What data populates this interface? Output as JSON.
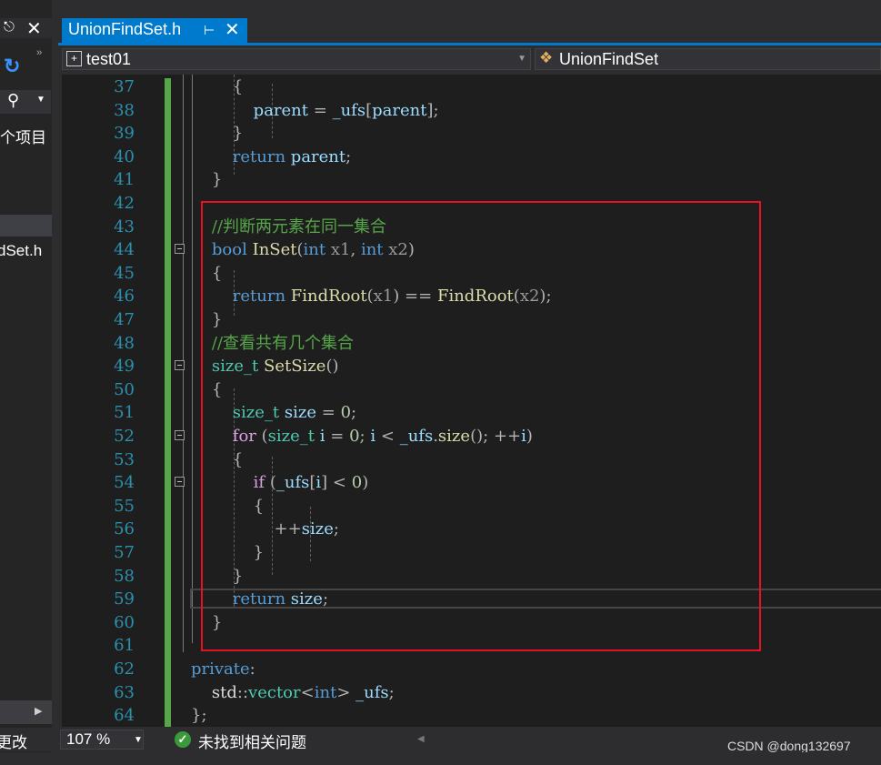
{
  "left_panel": {
    "text_item": "个项目",
    "text_file": "dSet.h",
    "bottom_label": "更改"
  },
  "tab": {
    "title": "UnionFindSet.h",
    "pin_icon": "pin-icon",
    "close_icon": "close-icon"
  },
  "navbar": {
    "project": "test01",
    "scope": "UnionFindSet"
  },
  "editor": {
    "line_numbers": [
      "37",
      "38",
      "39",
      "40",
      "41",
      "42",
      "43",
      "44",
      "45",
      "46",
      "47",
      "48",
      "49",
      "50",
      "51",
      "52",
      "53",
      "54",
      "55",
      "56",
      "57",
      "58",
      "59",
      "60",
      "61",
      "62",
      "63",
      "64"
    ],
    "lines": [
      "        {",
      "            parent = _ufs[parent];",
      "        }",
      "        return parent;",
      "    }",
      "",
      "    //判断两元素在同一集合",
      "    bool InSet(int x1, int x2)",
      "    {",
      "        return FindRoot(x1) == FindRoot(x2);",
      "    }",
      "    //查看共有几个集合",
      "    size_t SetSize()",
      "    {",
      "        size_t size = 0;",
      "        for (size_t i = 0; i < _ufs.size(); ++i)",
      "        {",
      "            if (_ufs[i] < 0)",
      "            {",
      "                ++size;",
      "            }",
      "        }",
      "        return size;",
      "    }",
      "",
      "private:",
      "    std::vector<int> _ufs;",
      "};"
    ]
  },
  "status": {
    "zoom": "107 %",
    "issues": "未找到相关问题",
    "watermark": "CSDN @dong132697"
  },
  "colors": {
    "accent": "#007acc",
    "keyword": "#569cd6",
    "control": "#d8a0df",
    "type": "#4ec9b0",
    "function": "#dcdcaa",
    "variable": "#9cdcfe",
    "comment": "#57a64a",
    "number": "#b5cea8",
    "highlight_box": "#e81123"
  }
}
